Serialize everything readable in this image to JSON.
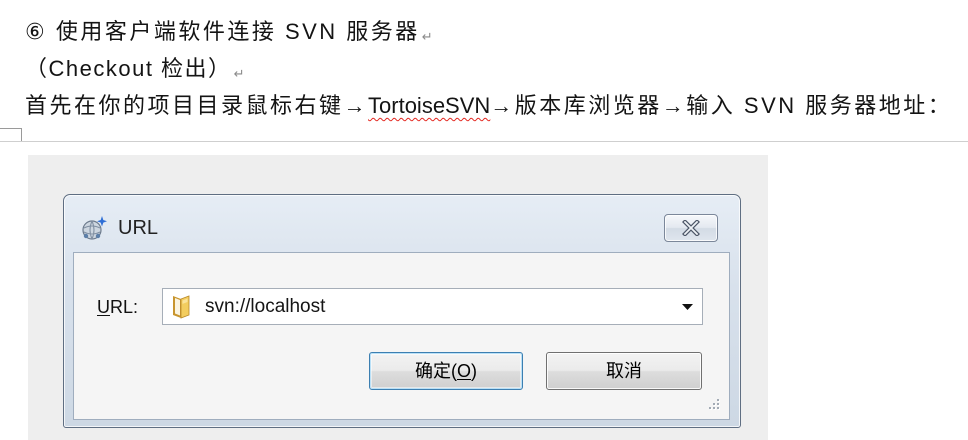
{
  "document": {
    "heading": {
      "text": "⑥ 使用客户端软件连接 SVN 服务器",
      "paragraph_mark": "↵"
    },
    "subheading": {
      "text": "（Checkout 检出）",
      "paragraph_mark": "↵"
    },
    "instruction": {
      "text_before": "首先在你的项目目录鼠标右键→",
      "misspelled_word": "TortoiseSVN",
      "text_after": "→版本库浏览器→输入 SVN 服务器地址："
    }
  },
  "dialog": {
    "title": "URL",
    "url_label": "URL:",
    "url_value": "svn://localhost",
    "ok_label": "确定(O)",
    "cancel_label": "取消",
    "icons": {
      "title": "repo-browser-icon",
      "close": "close-icon",
      "url_field": "folder-icon",
      "dropdown": "chevron-down-icon",
      "resize": "resize-grip-icon"
    }
  },
  "colors": {
    "spellcheck-underline": "#e3261f",
    "paragraph-mark": "#8a8a8a",
    "default-button-border": "#3c7fb1",
    "window-frame-border": "#5f6e82"
  }
}
